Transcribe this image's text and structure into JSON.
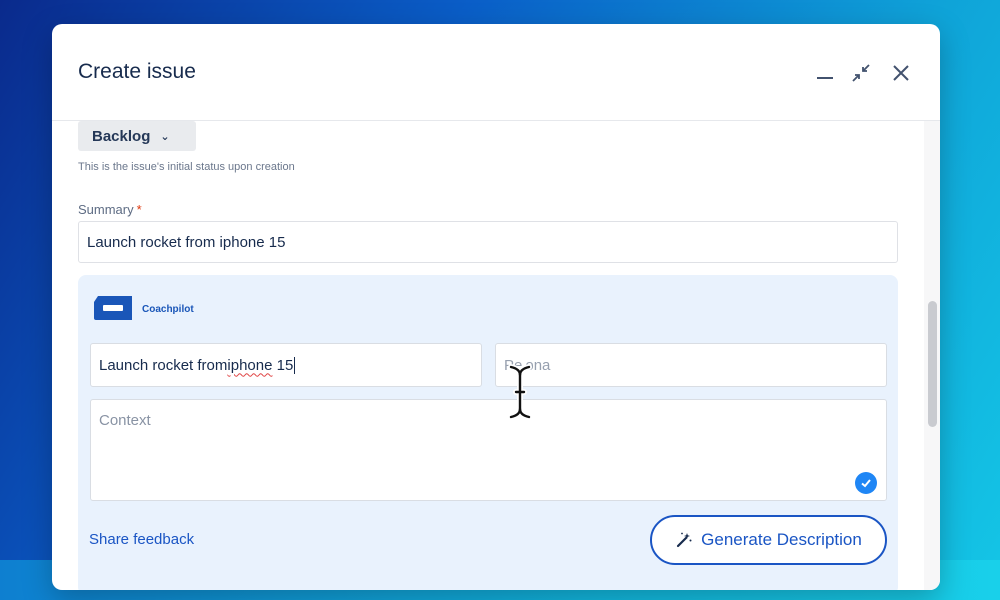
{
  "modal": {
    "title": "Create issue",
    "header_icons": [
      "minimize-icon",
      "collapse-icon",
      "close-icon"
    ]
  },
  "status": {
    "value": "Backlog",
    "hint": "This is the issue's initial status upon creation"
  },
  "summary": {
    "label": "Summary",
    "required_mark": "*",
    "value": "Launch rocket from iphone 15"
  },
  "coachpilot": {
    "brand": "Coachpilot",
    "title_value_prefix": "Launch rocket from ",
    "title_value_misspelled": "iphone",
    "title_value_suffix": " 15",
    "persona_placeholder": "Persona",
    "persona_visible": "Pe ona",
    "context_placeholder": "Context",
    "share_feedback": "Share feedback",
    "generate_button": "Generate Description"
  },
  "colors": {
    "accent": "#1a55c4",
    "panel_bg": "#e9f2fd",
    "check": "#1f86f5"
  }
}
